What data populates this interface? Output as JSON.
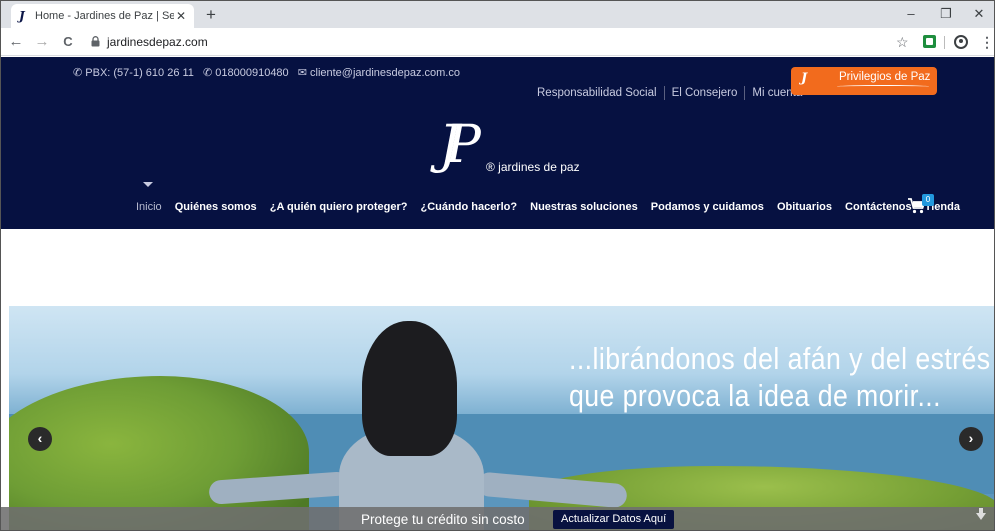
{
  "browser": {
    "tab_title": "Home - Jardines de Paz | Servicio",
    "tab_close": "✕",
    "new_tab": "+",
    "window_controls": {
      "minimize": "–",
      "restore": "❐",
      "close": "✕"
    },
    "nav": {
      "back": "←",
      "forward": "→",
      "reload": "C"
    },
    "url": "jardinesdepaz.com",
    "star": "☆",
    "menu": "⋮"
  },
  "header": {
    "contact": {
      "pbx": "✆ PBX: (57-1) 610 26 11",
      "phone": "✆ 018000910480",
      "email": "✉ cliente@jardinesdepaz.com.co"
    },
    "top_links": [
      "Responsabilidad Social",
      "El Consejero",
      "Mi cuenta"
    ],
    "privileges_button": "Privilegios de Paz",
    "logo_text": "® jardines de paz",
    "menu": [
      "Inicio",
      "Quiénes somos",
      "¿A quién quiero proteger?",
      "¿Cuándo hacerlo?",
      "Nuestras soluciones",
      "Podamos y cuidamos",
      "Obituarios",
      "Contáctenos",
      "Tienda"
    ],
    "cart_count": "0",
    "colors": {
      "header_bg": "#061141",
      "accent": "#f26b1d",
      "badge": "#2299dd"
    }
  },
  "hero": {
    "quote_line1": "...librándonos del afán y del estrés",
    "quote_line2": "que provoca la idea de morir...",
    "prev": "‹",
    "next": "›"
  },
  "bottom_bar": {
    "text": "Protege tu crédito sin costo",
    "button": "Actualizar Datos Aquí"
  },
  "icons": [
    "phone-icon",
    "email-icon",
    "cart-icon",
    "lock-icon",
    "star-icon",
    "profile-icon",
    "scroll-down-icon"
  ]
}
